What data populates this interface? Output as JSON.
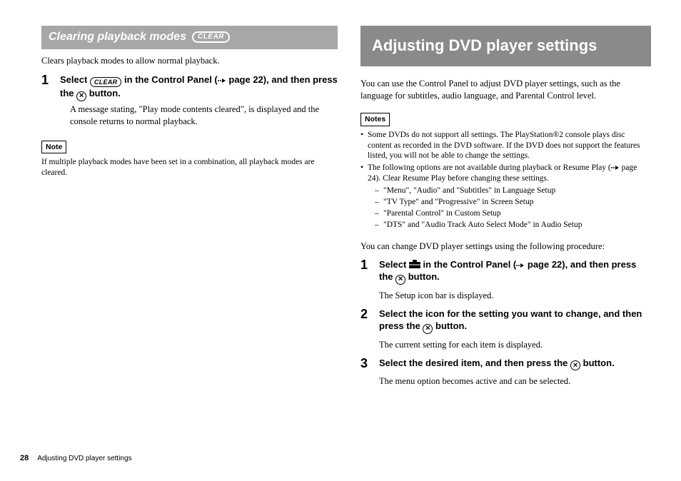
{
  "left": {
    "subheading": "Clearing playback modes",
    "clear_pill": "CLEAR",
    "intro": "Clears playback modes to allow normal playback.",
    "step1": {
      "num": "1",
      "title_a": "Select ",
      "title_b": " in the Control Panel (",
      "title_c": " page 22), and then press the ",
      "title_d": " button.",
      "desc": "A message stating, \"Play mode contents cleared\", is displayed and the console returns to normal playback."
    },
    "note_label": "Note",
    "note_text": "If multiple playback modes have been set in a combination, all playback modes are cleared."
  },
  "right": {
    "heading": "Adjusting DVD player settings",
    "intro": "You can use the Control Panel to adjust DVD player settings, such as the language for subtitles, audio language, and Parental Control level.",
    "notes_label": "Notes",
    "note_items": [
      "Some DVDs do not support all settings. The PlayStation®2 console plays disc content as recorded in the DVD software. If the DVD does not support the features listed, you will not be able to change the settings."
    ],
    "note2_a": "The following options are not available during playback or Resume Play (",
    "note2_b": " page 24). Clear Resume Play before changing these settings.",
    "note2_sub": [
      "\"Menu\", \"Audio\" and \"Subtitles\" in Language Setup",
      "\"TV Type\" and \"Progressive\" in Screen Setup",
      "\"Parental Control\" in Custom Setup",
      "\"DTS\" and \"Audio Track Auto Select Mode\" in Audio Setup"
    ],
    "procedure_intro": "You can change DVD player settings using the following procedure:",
    "step1": {
      "num": "1",
      "title_a": "Select ",
      "title_b": " in the Control Panel (",
      "title_c": " page 22), and then press the ",
      "title_d": " button.",
      "desc": "The Setup icon bar is displayed."
    },
    "step2": {
      "num": "2",
      "title_a": "Select the icon for the setting you want to change, and then press the ",
      "title_b": " button.",
      "desc": "The current setting for each item is displayed."
    },
    "step3": {
      "num": "3",
      "title_a": "Select the desired item, and then press the ",
      "title_b": " button.",
      "desc": "The menu option becomes active and can be selected."
    }
  },
  "footer": {
    "page": "28",
    "section": "Adjusting DVD player settings"
  },
  "icons": {
    "clear": "CLEAR"
  }
}
